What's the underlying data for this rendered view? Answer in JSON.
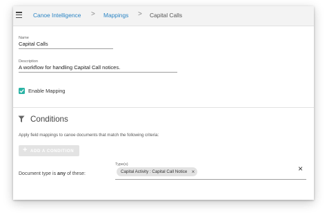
{
  "breadcrumb": {
    "items": [
      {
        "label": "Canoe Intelligence"
      },
      {
        "label": "Mappings"
      },
      {
        "label": "Capital Calls"
      }
    ],
    "separator": ">"
  },
  "form": {
    "name_label": "Name",
    "name_value": "Capital Calls",
    "description_label": "Description",
    "description_value": "A workflow for handling Capital Call notices.",
    "enable_mapping_label": "Enable Mapping",
    "enable_mapping_checked": true
  },
  "conditions": {
    "title": "Conditions",
    "description": "Apply field mappings to canoe documents that match the following criteria:",
    "add_button_icon": "+",
    "add_button_label": "ADD A CONDITION",
    "row": {
      "prefix": "Document type is",
      "emphasis": "any",
      "suffix": "of these:",
      "types_label": "Type(s)",
      "chip_label": "Capital Activity : Capital Call Notice",
      "chip_remove": "×",
      "clear": "×"
    }
  },
  "colors": {
    "link": "#2a84c4",
    "checkbox": "#2bb3a5",
    "disabled_button": "#e3e3e3"
  },
  "icons": {
    "menu": "hamburger-menu-icon",
    "filter": "filter-icon",
    "check": "checkmark-icon"
  }
}
